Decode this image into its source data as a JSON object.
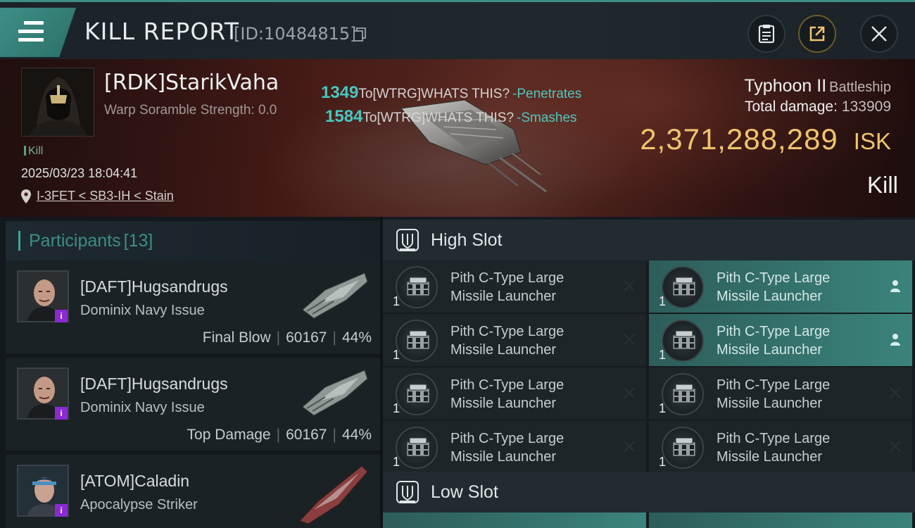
{
  "header": {
    "title": "KILL REPORT",
    "id_text": "[ID:10484815]"
  },
  "victim": {
    "name": "[RDK]StarikVaha",
    "warp_text": "Warp Soramble Strength: 0.0",
    "kill_tag": "Kill",
    "datetime": "2025/03/23 18:04:41",
    "location": "I-3FET < SB3-IH < Stain"
  },
  "damage_feed": [
    {
      "amount": "1349",
      "target": "To[WTRG]WHATS THIS?",
      "verb": "-Penetrates"
    },
    {
      "amount": "1584",
      "target": "To[WTRG]WHATS THIS?",
      "verb": "-Smashes"
    }
  ],
  "ship": {
    "name": "Typhoon II",
    "class": "Battleship",
    "total_damage_label": "Total damage:",
    "total_damage": "133909",
    "isk_value": "2,371,288,289",
    "isk_unit": "ISK",
    "result": "Kill"
  },
  "participants": {
    "label": "Participants",
    "count": "[13]",
    "items": [
      {
        "name": "[DAFT]Hugsandrugs",
        "ship": "Dominix Navy Issue",
        "role": "Final Blow",
        "damage": "60167",
        "percent": "44%"
      },
      {
        "name": "[DAFT]Hugsandrugs",
        "ship": "Dominix Navy Issue",
        "role": "Top Damage",
        "damage": "60167",
        "percent": "44%"
      },
      {
        "name": "[ATOM]Caladin",
        "ship": "Apocalypse Striker",
        "role": "",
        "damage": "",
        "percent": ""
      }
    ]
  },
  "slots": {
    "high_label": "High Slot",
    "low_label": "Low Slot",
    "high_modules": [
      {
        "line1": "Pith C-Type Large",
        "line2": "Missile Launcher",
        "qty": "1",
        "status": "destroyed"
      },
      {
        "line1": "Pith C-Type Large",
        "line2": "Missile Launcher",
        "qty": "1",
        "status": "dropped"
      },
      {
        "line1": "Pith C-Type Large",
        "line2": "Missile Launcher",
        "qty": "1",
        "status": "destroyed"
      },
      {
        "line1": "Pith C-Type Large",
        "line2": "Missile Launcher",
        "qty": "1",
        "status": "dropped"
      },
      {
        "line1": "Pith C-Type Large",
        "line2": "Missile Launcher",
        "qty": "1",
        "status": "destroyed"
      },
      {
        "line1": "Pith C-Type Large",
        "line2": "Missile Launcher",
        "qty": "1",
        "status": "destroyed"
      },
      {
        "line1": "Pith C-Type Large",
        "line2": "Missile Launcher",
        "qty": "1",
        "status": "destroyed"
      },
      {
        "line1": "Pith C-Type Large",
        "line2": "Missile Launcher",
        "qty": "1",
        "status": "destroyed"
      }
    ]
  },
  "colors": {
    "accent": "#3f8d86",
    "isk": "#f0c46e",
    "damage_number": "#46c8c0",
    "fitted_module": "#3b837c"
  }
}
